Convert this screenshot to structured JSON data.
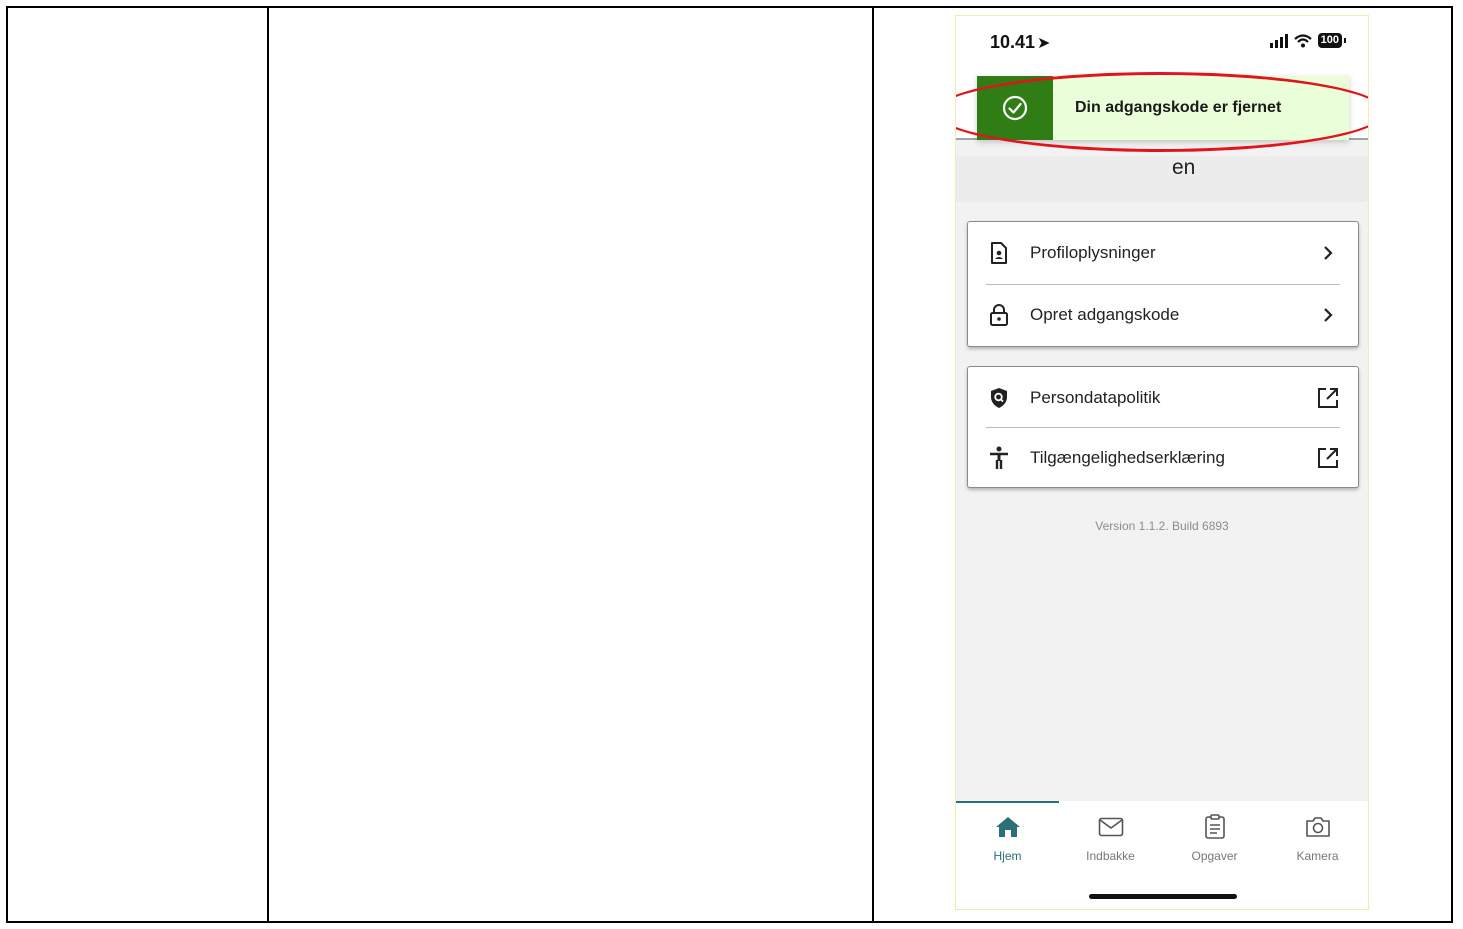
{
  "status_bar": {
    "time": "10.41",
    "battery": "100"
  },
  "toast": {
    "message": "Din adgangskode er fjernet"
  },
  "profile_name_fragment": "en",
  "menu_group_1": [
    {
      "label": "Profiloplysninger",
      "icon": "profile-document-icon",
      "trail": "chevron-right-icon"
    },
    {
      "label": "Opret adgangskode",
      "icon": "padlock-icon",
      "trail": "chevron-right-icon"
    }
  ],
  "menu_group_2": [
    {
      "label": "Persondatapolitik",
      "icon": "shield-search-icon",
      "trail": "external-link-icon"
    },
    {
      "label": "Tilgængelighedserklæring",
      "icon": "accessibility-icon",
      "trail": "external-link-icon"
    }
  ],
  "version_text": "Version 1.1.2. Build 6893",
  "tabs": [
    {
      "label": "Hjem",
      "icon": "home-icon",
      "active": true
    },
    {
      "label": "Indbakke",
      "icon": "mail-icon",
      "active": false
    },
    {
      "label": "Opgaver",
      "icon": "clipboard-icon",
      "active": false
    },
    {
      "label": "Kamera",
      "icon": "camera-icon",
      "active": false
    }
  ],
  "colors": {
    "toast_accent": "#2f7d14",
    "toast_background": "#eaffd9",
    "highlight": "#e0141a",
    "tab_active": "#2a6f7a"
  }
}
